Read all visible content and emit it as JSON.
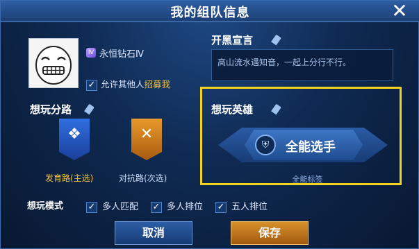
{
  "dialog": {
    "title": "我的组队信息",
    "close_icon": "close-icon"
  },
  "profile": {
    "rank_badge": "Ⅳ",
    "rank_text": "永恒钻石Ⅳ",
    "allow_checked": true,
    "allow_prefix": "允许其他人",
    "allow_highlight": "招募我"
  },
  "declaration": {
    "title": "开黑宣言",
    "text": "高山流水遇知音，一起上分行不行。"
  },
  "route": {
    "title": "想玩分路",
    "items": [
      {
        "label": "发育路(主选)",
        "icon": "sword-rune-icon",
        "color": "#f4c542"
      },
      {
        "label": "对抗路(次选)",
        "icon": "crossed-swords-icon",
        "color": "#cfe0ff"
      }
    ]
  },
  "hero": {
    "title": "想玩英雄",
    "name": "全能选手",
    "icon": "helmet-icon",
    "tag": "全能标签"
  },
  "modes": {
    "title": "想玩模式",
    "items": [
      {
        "label": "多人匹配",
        "checked": true
      },
      {
        "label": "多人排位",
        "checked": true
      },
      {
        "label": "五人排位",
        "checked": true
      }
    ]
  },
  "buttons": {
    "cancel": "取消",
    "save": "保存"
  },
  "colors": {
    "highlight_frame": "#f5d21d",
    "accent_gold": "#f4c542"
  }
}
